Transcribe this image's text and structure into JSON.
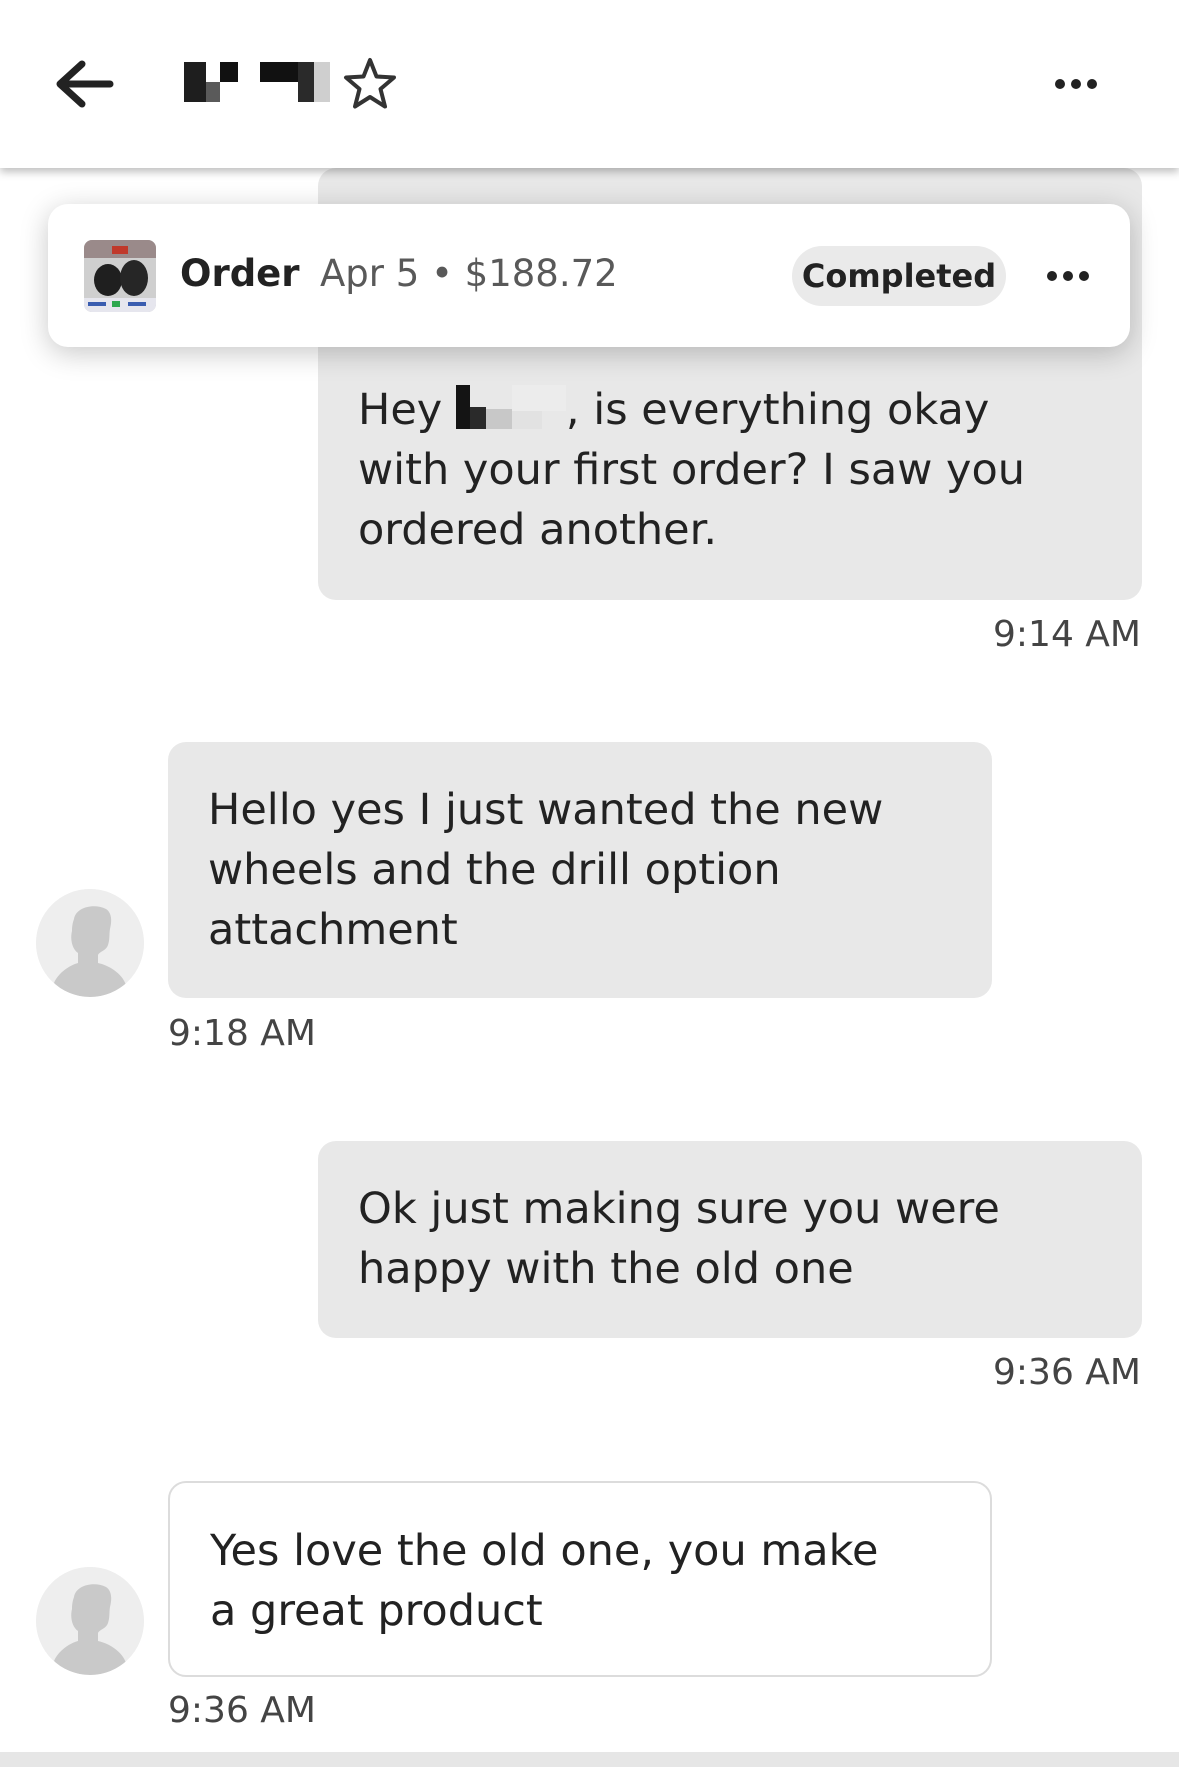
{
  "header": {
    "back_icon": "arrow-left-icon",
    "star_icon": "star-outline-icon",
    "more_icon": "more-horizontal-icon"
  },
  "order": {
    "label": "Order",
    "meta": "Apr 5 • $188.72",
    "status": "Completed",
    "more_icon": "more-horizontal-icon"
  },
  "messages": [
    {
      "from": "me",
      "lines": [
        "Hey ",
        ", is everything okay",
        "with your first order? I saw you",
        "ordered another."
      ],
      "time": "9:14 AM"
    },
    {
      "from": "them",
      "lines": [
        "Hello yes I just wanted the new",
        "wheels and the drill option",
        "attachment"
      ],
      "time": "9:18 AM"
    },
    {
      "from": "me",
      "lines": [
        "Ok just making sure you were",
        "happy with the old one"
      ],
      "time": "9:36 AM"
    },
    {
      "from": "them",
      "lines": [
        "Yes love the old one, you make",
        "a great product"
      ],
      "time": "9:36 AM"
    }
  ],
  "colors": {
    "bubble": "#e8e8e8",
    "status_pill": "#eaeaea",
    "text": "#222222",
    "muted": "#595959"
  }
}
